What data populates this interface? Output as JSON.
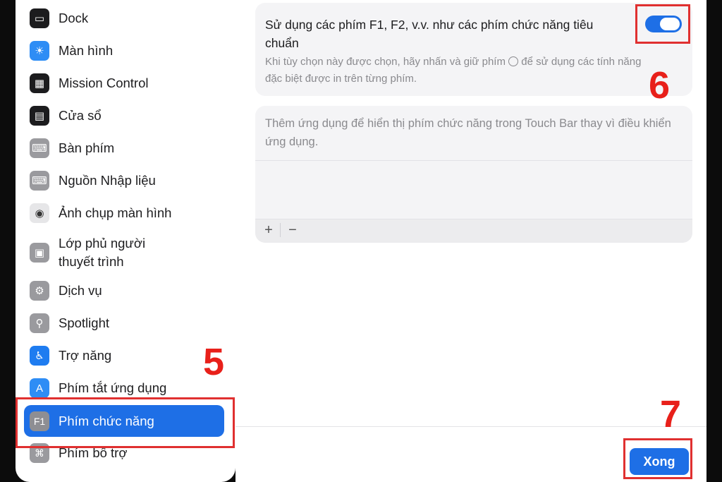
{
  "sidebar": {
    "items": [
      {
        "label": "Dock",
        "icon": "dock-icon",
        "color": "#1c1c1e"
      },
      {
        "label": "Màn hình",
        "icon": "sun-icon",
        "color": "#2e8df5"
      },
      {
        "label": "Mission Control",
        "icon": "mission-control-icon",
        "color": "#1c1c1e"
      },
      {
        "label": "Cửa sổ",
        "icon": "window-icon",
        "color": "#1c1c1e"
      },
      {
        "label": "Bàn phím",
        "icon": "keyboard-icon",
        "color": "#9a9a9e"
      },
      {
        "label": "Nguồn Nhập liệu",
        "icon": "keyboard-icon",
        "color": "#9a9a9e"
      },
      {
        "label": "Ảnh chụp màn hình",
        "icon": "camera-icon",
        "color": "#e6e6e8"
      },
      {
        "label": "Lớp phủ người thuyết trình",
        "icon": "presenter-icon",
        "color": "#9a9a9e"
      },
      {
        "label": "Dịch vụ",
        "icon": "gears-icon",
        "color": "#9a9a9e"
      },
      {
        "label": "Spotlight",
        "icon": "magnifier-icon",
        "color": "#9a9a9e"
      },
      {
        "label": "Trợ năng",
        "icon": "accessibility-icon",
        "color": "#1e7cf0"
      },
      {
        "label": "Phím tắt ứng dụng",
        "icon": "app-store-icon",
        "color": "#2e8df5"
      },
      {
        "label": "Phím chức năng",
        "icon": "f1-icon",
        "icon_text": "F1",
        "color": "#8e8e93"
      },
      {
        "label": "Phím bổ trợ",
        "icon": "command-icon",
        "icon_text": "⌘",
        "color": "#9a9a9e"
      }
    ],
    "selected_index": 12
  },
  "main": {
    "option_title": "Sử dụng các phím F1, F2, v.v. như các phím chức năng tiêu chuẩn",
    "option_desc_before": "Khi tùy chọn này được chọn, hãy nhấn và giữ phím",
    "option_desc_after": "để sử dụng các tính năng đặc biệt được in trên từng phím.",
    "toggle_on": true,
    "apps_hint": "Thêm ứng dụng để hiển thị phím chức năng trong Touch Bar thay vì điều khiển ứng dụng.",
    "add_label": "+",
    "remove_label": "−",
    "done_label": "Xong"
  },
  "annotations": {
    "step5": "5",
    "step6": "6",
    "step7": "7",
    "color": "#e03030"
  },
  "colors": {
    "accent": "#1e6fe6"
  }
}
